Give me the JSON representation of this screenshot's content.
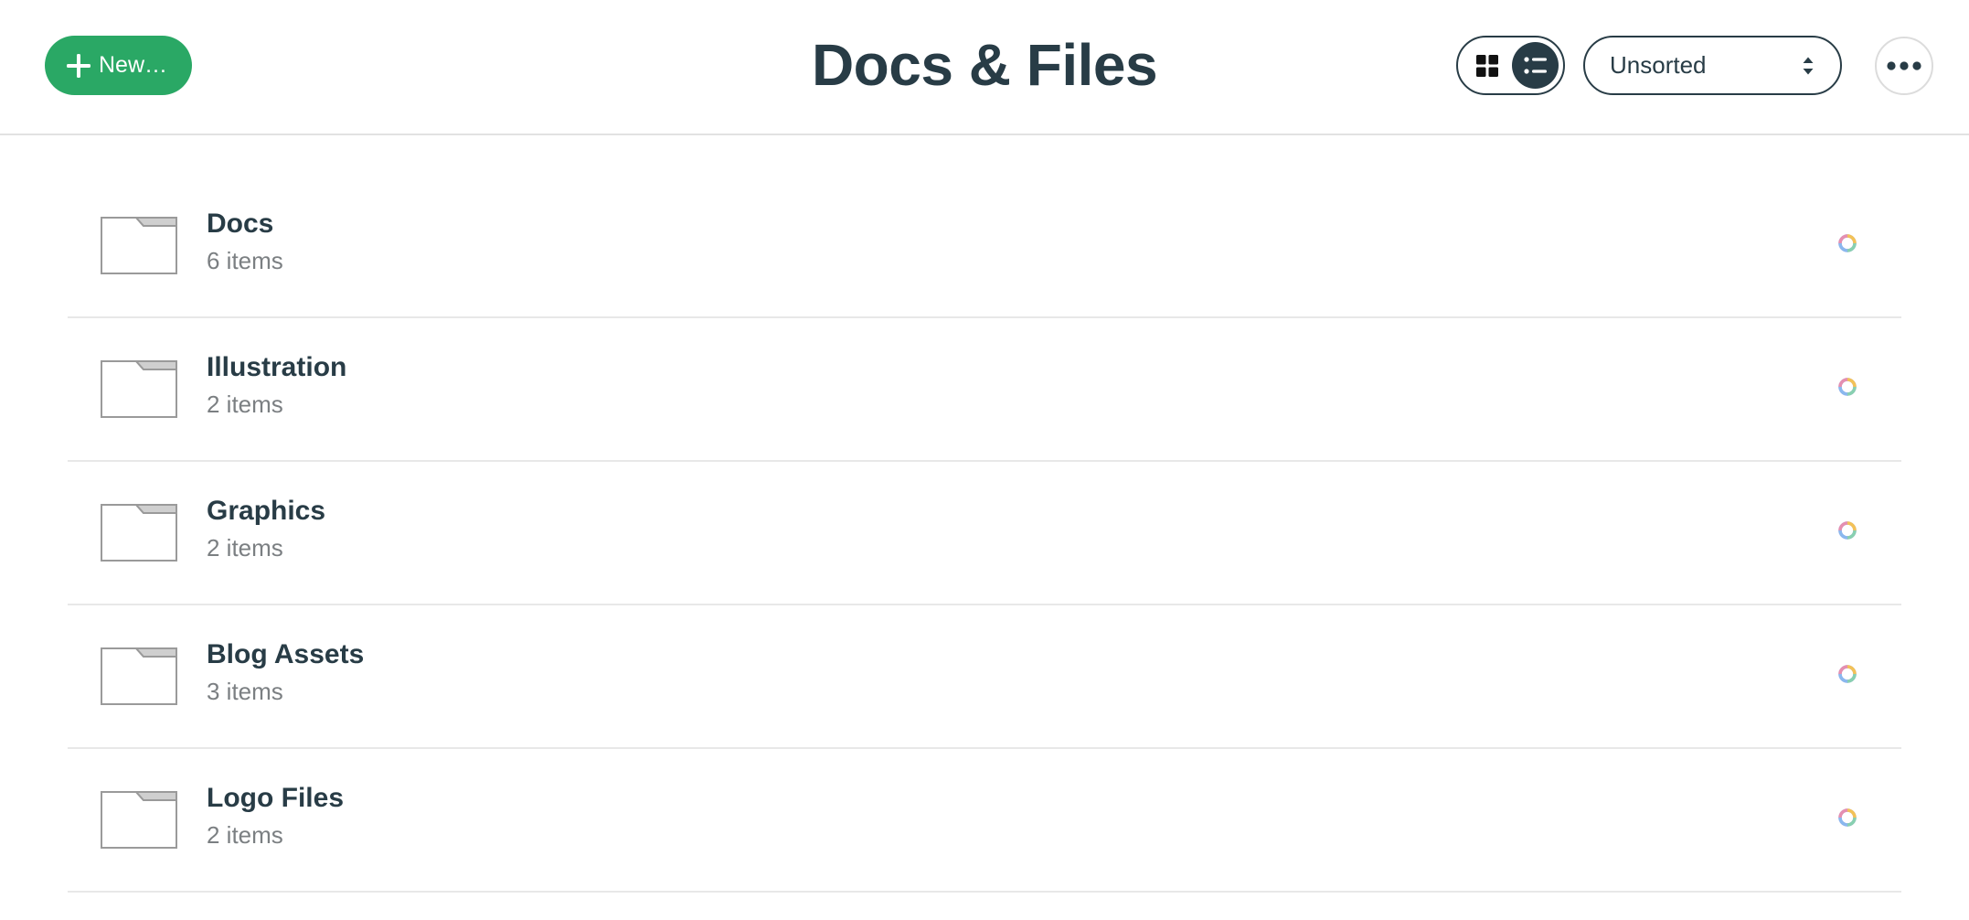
{
  "header": {
    "title": "Docs & Files",
    "new_button_label": "New…",
    "sort": {
      "selected": "Unsorted"
    },
    "view_mode": "list"
  },
  "colors": {
    "accent_green": "#2aa865",
    "text_dark": "#283c46",
    "text_muted": "#7b7f82"
  },
  "folders": [
    {
      "name": "Docs",
      "count": "6 items"
    },
    {
      "name": "Illustration",
      "count": "2 items"
    },
    {
      "name": "Graphics",
      "count": "2 items"
    },
    {
      "name": "Blog Assets",
      "count": "3 items"
    },
    {
      "name": "Logo Files",
      "count": "2 items"
    }
  ],
  "icons": {
    "new": "plus-icon",
    "grid": "grid-view-icon",
    "list": "list-view-icon",
    "sort": "sort-arrows-icon",
    "more": "more-options-icon",
    "folder": "folder-icon",
    "status": "status-ring-icon"
  }
}
